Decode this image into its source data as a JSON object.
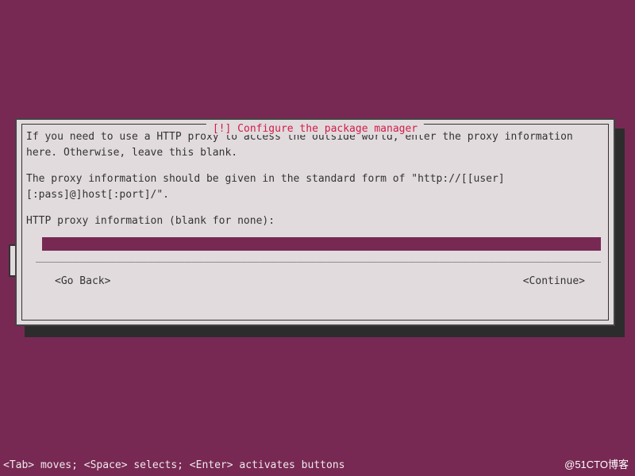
{
  "dialog": {
    "title_prefix": "[!]",
    "title": "Configure the package manager",
    "instruction_1": "If you need to use a HTTP proxy to access the outside world, enter the proxy information here. Otherwise, leave this blank.",
    "instruction_2": "The proxy information should be given in the standard form of \"http://[[user][:pass]@]host[:port]/\".",
    "prompt_label": "HTTP proxy information (blank for none):",
    "input_value": "",
    "go_back_label": "<Go Back>",
    "continue_label": "<Continue>",
    "underline": "____________________________________________________________________________________________"
  },
  "footer": {
    "hint": "<Tab> moves; <Space> selects; <Enter> activates buttons"
  },
  "watermark": "@51CTO博客",
  "colors": {
    "background": "#772953",
    "dialog_bg": "#e2dbdd",
    "title_color": "#d01c4a",
    "text_color": "#333"
  }
}
